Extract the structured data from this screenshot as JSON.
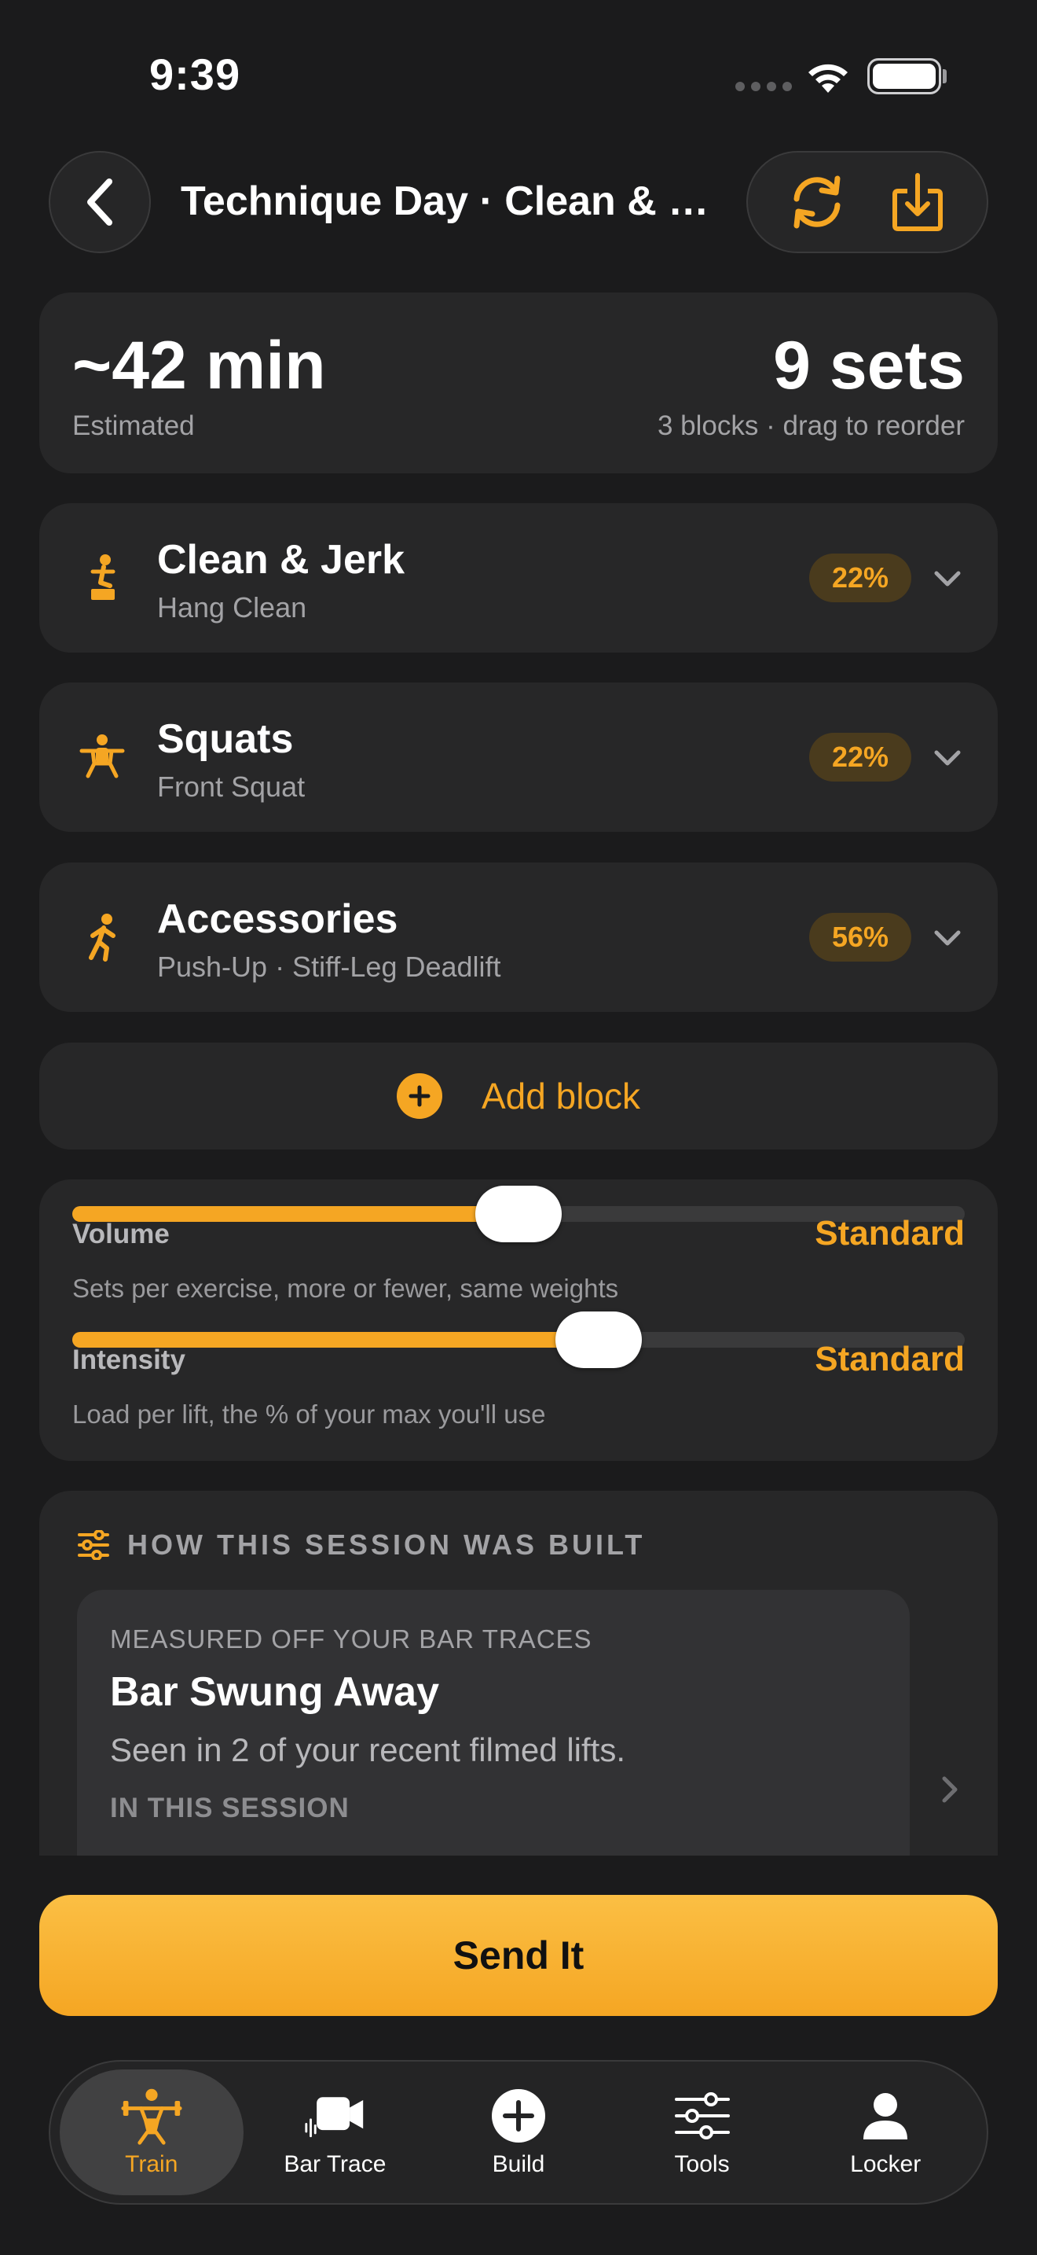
{
  "status_bar": {
    "time": "9:39"
  },
  "header": {
    "title": "Technique Day · Clean & Jerk"
  },
  "summary": {
    "duration": "~42 min",
    "duration_label": "Estimated",
    "sets": "9 sets",
    "sets_label": "3 blocks · drag to reorder"
  },
  "blocks": [
    {
      "name": "Clean & Jerk",
      "exercises": "Hang Clean",
      "percent": "22%",
      "icon": "clean-jerk-icon"
    },
    {
      "name": "Squats",
      "exercises": "Front Squat",
      "percent": "22%",
      "icon": "squat-icon"
    },
    {
      "name": "Accessories",
      "exercises": "Push-Up · Stiff-Leg Deadlift",
      "percent": "56%",
      "icon": "running-figure-icon"
    }
  ],
  "add_block": {
    "label": "Add block"
  },
  "sliders": {
    "volume": {
      "label": "Volume",
      "value": "Standard",
      "description": "Sets per exercise, more or fewer, same weights",
      "level": 0.5
    },
    "intensity": {
      "label": "Intensity",
      "value": "Standard",
      "description": "Load per lift, the % of your max you'll use",
      "level": 0.59
    }
  },
  "built": {
    "heading": "HOW THIS SESSION WAS BUILT",
    "card": {
      "kicker": "MEASURED OFF YOUR BAR TRACES",
      "title": "Bar Swung Away",
      "body": "Seen in 2 of your recent filmed lifts.",
      "section": "IN THIS SESSION"
    }
  },
  "send_button": {
    "label": "Send It"
  },
  "tabs": [
    {
      "label": "Train",
      "active": true
    },
    {
      "label": "Bar Trace",
      "active": false
    },
    {
      "label": "Build",
      "active": false
    },
    {
      "label": "Tools",
      "active": false
    },
    {
      "label": "Locker",
      "active": false
    }
  ],
  "colors": {
    "accent": "#f5a623",
    "background": "#1b1b1c",
    "card": "#272728"
  }
}
